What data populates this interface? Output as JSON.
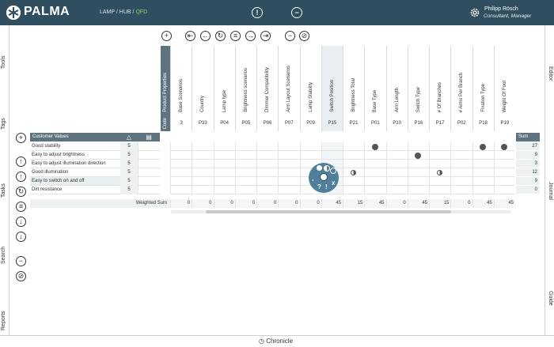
{
  "header": {
    "logo": "PALMA",
    "breadcrumb": [
      "LAMP",
      "HUB",
      "QFD"
    ],
    "breadcrumb_sep": "/",
    "info_icon": "!",
    "minus_icon": "−",
    "user_name": "Philipp Rösch",
    "user_role": "Consultant, Manager"
  },
  "left_tabs": [
    "Tools",
    "Tags",
    "Tasks",
    "Search",
    "Reports"
  ],
  "right_tabs": [
    "Editor",
    "Journal",
    "Guide"
  ],
  "footer": {
    "label": "Chronicle"
  },
  "toolbar": {
    "glyphs": [
      "+",
      "⇤",
      "←",
      "↻",
      "≡",
      "→",
      "⇥",
      "−",
      "⊘"
    ]
  },
  "left_tools": [
    "+",
    "↑",
    "↑",
    "↻",
    "≡",
    "↓",
    "↓",
    "−",
    "⊘"
  ],
  "matrix": {
    "section_label": "Product Properties",
    "code_label": "Code",
    "customer_values_label": "Customer Values",
    "sum_label": "Sum",
    "weighted_sum_label": "Weighted Sum",
    "columns": [
      {
        "name": "Base Scenarios",
        "code": "3"
      },
      {
        "name": "Country",
        "code": "P33"
      },
      {
        "name": "Lamp type",
        "code": "P04"
      },
      {
        "name": "Brightness scenarios",
        "code": "P05"
      },
      {
        "name": "Dimmer Compatibility",
        "code": "P06"
      },
      {
        "name": "Arm Layout Scenarios",
        "code": "P07"
      },
      {
        "name": "Lamp Stability",
        "code": "P09"
      },
      {
        "name": "Switch Position",
        "code": "P15"
      },
      {
        "name": "Brightness Total",
        "code": "P21"
      },
      {
        "name": "Base Type",
        "code": "P01"
      },
      {
        "name": "Arm Length",
        "code": "P10"
      },
      {
        "name": "Switch Type",
        "code": "P16"
      },
      {
        "name": "# Of Branches",
        "code": "P17"
      },
      {
        "name": "# Arms Per Branch",
        "code": "P02"
      },
      {
        "name": "Fixation Type",
        "code": "P18"
      },
      {
        "name": "Weight Of Foot",
        "code": "P19"
      }
    ],
    "rows": [
      {
        "label": "Good stability",
        "weight": "5",
        "sum": "27"
      },
      {
        "label": "Easy to adjust brightness",
        "weight": "5",
        "sum": "9"
      },
      {
        "label": "Easy to adjust illumination direction",
        "weight": "5",
        "sum": "3"
      },
      {
        "label": "Good illumination",
        "weight": "5",
        "sum": "12"
      },
      {
        "label": "Easy to switch on and off",
        "weight": "5",
        "sum": "9"
      },
      {
        "label": "Dirt resistance",
        "weight": "5",
        "sum": "0"
      }
    ],
    "marks": [
      {
        "row": 0,
        "col": 9,
        "type": "full"
      },
      {
        "row": 0,
        "col": 14,
        "type": "full"
      },
      {
        "row": 0,
        "col": 15,
        "type": "full"
      },
      {
        "row": 1,
        "col": 11,
        "type": "full"
      },
      {
        "row": 3,
        "col": 8,
        "type": "half"
      },
      {
        "row": 3,
        "col": 12,
        "type": "half"
      }
    ],
    "weighted_sums": [
      "0",
      "0",
      "0",
      "0",
      "0",
      "0",
      "0",
      "45",
      "15",
      "45",
      "0",
      "45",
      "15",
      "0",
      "45",
      "45"
    ]
  },
  "popup": {
    "glyphs": [
      "-",
      "?",
      "!",
      "x"
    ]
  },
  "colors": {
    "header_bg": "#2f4e5f",
    "accent_green": "#8fd16a",
    "popup_bg": "#4f7f99"
  }
}
